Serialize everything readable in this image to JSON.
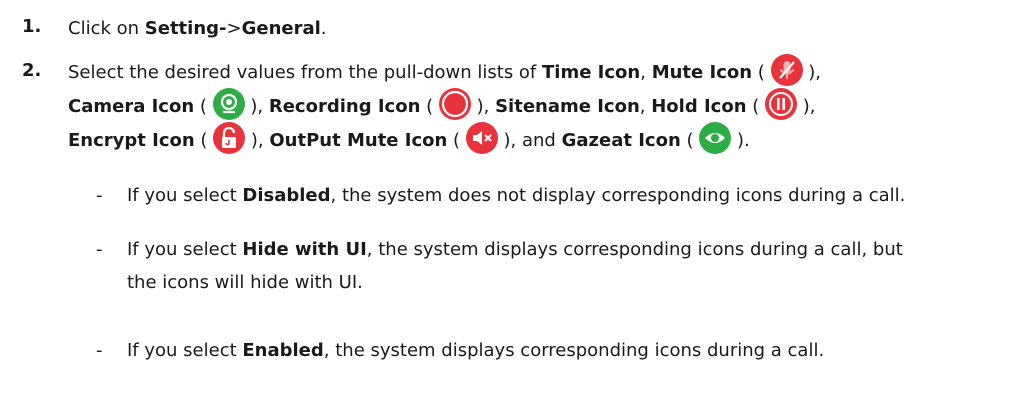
{
  "steps": [
    {
      "number": "1.",
      "text_a": "Click on ",
      "bold_a": "Setting-",
      "text_b": ">",
      "bold_b": "General",
      "text_c": "."
    },
    {
      "number": "2.",
      "line1": {
        "text_a": "Select the desired values from the pull-down lists of ",
        "bold_time": "Time Icon",
        "comma_1": ", ",
        "bold_mute": "Mute Icon",
        "open_paren": " ( ",
        "close_paren": " ),"
      },
      "line2": {
        "bold_camera": "Camera Icon",
        "open_1": " ( ",
        "close_1": " ), ",
        "bold_recording": "Recording Icon",
        "open_2": " ( ",
        "close_2": " ), ",
        "bold_sitename": "Sitename Icon",
        "comma": ", ",
        "bold_hold": "Hold Icon",
        "open_3": " (",
        "close_3": " ),"
      },
      "line3": {
        "bold_encrypt": "Encrypt Icon",
        "open_1": " ( ",
        "close_1": " ), ",
        "bold_output": "OutPut Mute Icon",
        "open_2": " ( ",
        "close_2": " ), and ",
        "bold_gazeat": "Gazeat Icon",
        "open_3": " ( ",
        "close_3": " )."
      }
    }
  ],
  "bullets": [
    {
      "dash": "-",
      "text_a": "If you select ",
      "bold": "Disabled",
      "text_b": ", the system does not display corresponding icons during a call."
    },
    {
      "dash": "-",
      "text_a": "If you select ",
      "bold": "Hide with UI",
      "text_b": ", the system displays corresponding icons during a call, but",
      "continuation": "the icons will hide with UI."
    },
    {
      "dash": "-",
      "text_a": "If you select ",
      "bold": "Enabled",
      "text_b": ", the system displays corresponding icons during a call."
    }
  ],
  "icons": {
    "mute": {
      "name": "mic-muted-icon",
      "color": "#e8323c"
    },
    "camera": {
      "name": "camera-icon",
      "color": "#2eac45"
    },
    "recording": {
      "name": "recording-icon",
      "color": "#e8323c"
    },
    "hold": {
      "name": "hold-icon",
      "color": "#e8323c"
    },
    "encrypt": {
      "name": "unlocked-icon",
      "color": "#e8323c"
    },
    "output_mute": {
      "name": "speaker-muted-icon",
      "color": "#e8323c"
    },
    "gazeat": {
      "name": "eye-icon",
      "color": "#2eac45"
    }
  }
}
